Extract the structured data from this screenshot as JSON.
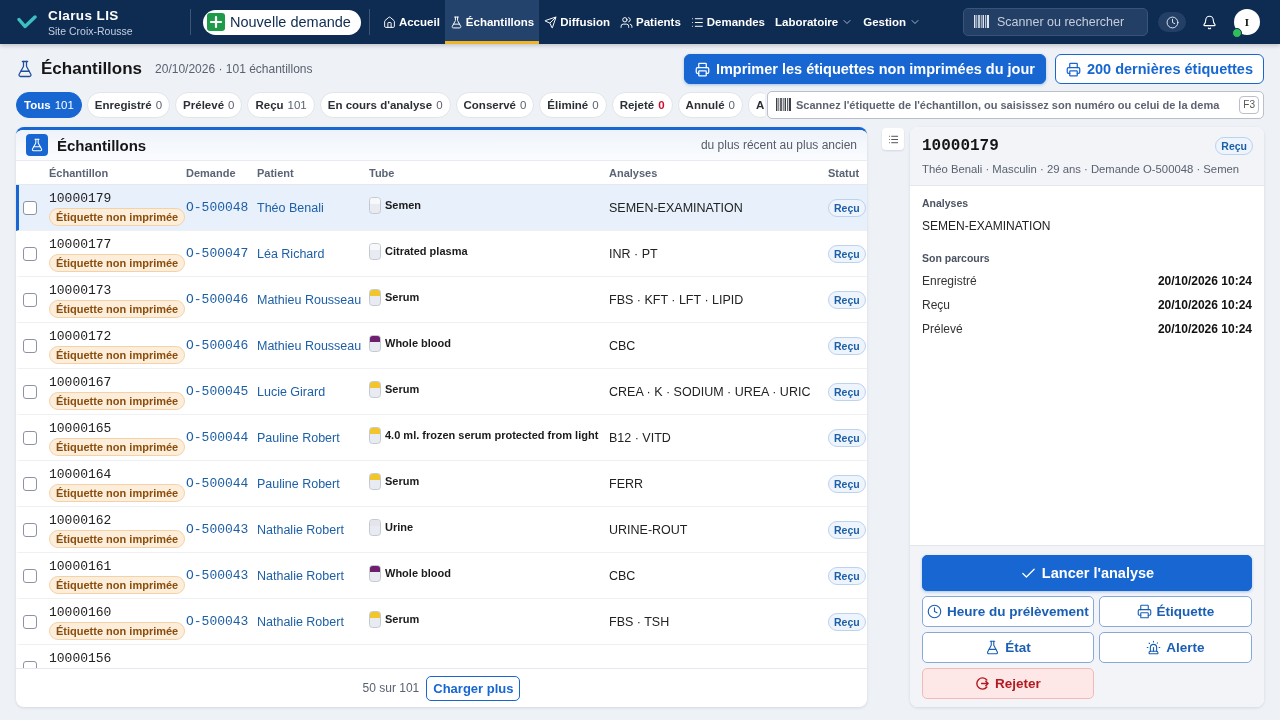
{
  "top_bar": {
    "brand": "Clarus LIS",
    "site": "Site Croix-Rousse",
    "new_request": "Nouvelle demande",
    "nav": [
      {
        "label": "Accueil",
        "kind": "link",
        "selected": false
      },
      {
        "label": "Échantillons",
        "kind": "link",
        "selected": true
      },
      {
        "label": "Diffusion",
        "kind": "link",
        "selected": false
      },
      {
        "label": "Patients",
        "kind": "link",
        "selected": false
      },
      {
        "label": "Demandes",
        "kind": "link",
        "selected": false
      },
      {
        "label": "Laboratoire",
        "kind": "menu",
        "selected": false
      },
      {
        "label": "Gestion",
        "kind": "menu",
        "selected": false
      }
    ],
    "search": {
      "placeholder": "Scanner ou rechercher"
    },
    "user": {
      "initial": "I",
      "online": true
    }
  },
  "page": {
    "title": "Échantillons",
    "subtitle": "20/10/2026 · 101 échantillons",
    "actions": [
      {
        "label": "Imprimer les étiquettes non imprimées du jour",
        "kind": "primary"
      },
      {
        "label": "200 dernières étiquettes",
        "kind": "secondary"
      }
    ]
  },
  "filters": [
    {
      "label": "Tous",
      "count": "101",
      "selected": true,
      "alert": false
    },
    {
      "label": "Enregistré",
      "count": "0",
      "selected": false,
      "alert": false
    },
    {
      "label": "Prélevé",
      "count": "0",
      "selected": false,
      "alert": false
    },
    {
      "label": "Reçu",
      "count": "101",
      "selected": false,
      "alert": false
    },
    {
      "label": "En cours d'analyse",
      "count": "0",
      "selected": false,
      "alert": false
    },
    {
      "label": "Conservé",
      "count": "0",
      "selected": false,
      "alert": false
    },
    {
      "label": "Éliminé",
      "count": "0",
      "selected": false,
      "alert": false
    },
    {
      "label": "Rejeté",
      "count": "0",
      "selected": false,
      "alert": true
    },
    {
      "label": "Annulé",
      "count": "0",
      "selected": false,
      "alert": false
    },
    {
      "label": "A",
      "selected": false
    }
  ],
  "scan_field": {
    "placeholder": "Scannez l'étiquette de l'échantillon, ou saisissez son numéro ou celui de la dema",
    "shortcut": "F3"
  },
  "samples": {
    "title": "Échantillons",
    "sort": "du plus récent au plus ancien",
    "columns": [
      "Échantillon",
      "Demande",
      "Patient",
      "Tube",
      "Analyses",
      "Statut"
    ],
    "rows": [
      {
        "selected": true,
        "checked": false,
        "sample": "10000179",
        "badge": "Étiquette non imprimée",
        "request": "O-500048",
        "patient": "Théo Benali",
        "tube": {
          "name": "Semen",
          "color": "#f7f8fa"
        },
        "analyses": "SEMEN-EXAMINATION",
        "status": "Reçu"
      },
      {
        "selected": false,
        "checked": false,
        "sample": "10000177",
        "badge": "Étiquette non imprimée",
        "request": "O-500047",
        "patient": "Léa Richard",
        "tube": {
          "name": "Citrated plasma",
          "color": "#f7f8fa"
        },
        "analyses": "INR · PT",
        "status": "Reçu"
      },
      {
        "selected": false,
        "checked": false,
        "sample": "10000173",
        "badge": "Étiquette non imprimée",
        "request": "O-500046",
        "patient": "Mathieu Rousseau",
        "tube": {
          "name": "Serum",
          "color": "#f2c52a"
        },
        "analyses": "FBS · KFT · LFT · LIPID",
        "status": "Reçu"
      },
      {
        "selected": false,
        "checked": false,
        "sample": "10000172",
        "badge": "Étiquette non imprimée",
        "request": "O-500046",
        "patient": "Mathieu Rousseau",
        "tube": {
          "name": "Whole blood",
          "color": "#6e1f6e"
        },
        "analyses": "CBC",
        "status": "Reçu"
      },
      {
        "selected": false,
        "checked": false,
        "sample": "10000167",
        "badge": "Étiquette non imprimée",
        "request": "O-500045",
        "patient": "Lucie Girard",
        "tube": {
          "name": "Serum",
          "color": "#f2c52a"
        },
        "analyses": "CREA · K · SODIUM · UREA · URIC",
        "status": "Reçu"
      },
      {
        "selected": false,
        "checked": false,
        "sample": "10000165",
        "badge": "Étiquette non imprimée",
        "request": "O-500044",
        "patient": "Pauline Robert",
        "tube": {
          "name": "4.0 ml. frozen serum protected from light",
          "color": "#f2c52a"
        },
        "analyses": "B12 · VITD",
        "status": "Reçu"
      },
      {
        "selected": false,
        "checked": false,
        "sample": "10000164",
        "badge": "Étiquette non imprimée",
        "request": "O-500044",
        "patient": "Pauline Robert",
        "tube": {
          "name": "Serum",
          "color": "#f2c52a"
        },
        "analyses": "FERR",
        "status": "Reçu"
      },
      {
        "selected": false,
        "checked": false,
        "sample": "10000162",
        "badge": "Étiquette non imprimée",
        "request": "O-500043",
        "patient": "Nathalie Robert",
        "tube": {
          "name": "Urine",
          "color": "#e3e5ea"
        },
        "analyses": "URINE-ROUT",
        "status": "Reçu"
      },
      {
        "selected": false,
        "checked": false,
        "sample": "10000161",
        "badge": "Étiquette non imprimée",
        "request": "O-500043",
        "patient": "Nathalie Robert",
        "tube": {
          "name": "Whole blood",
          "color": "#6e1f6e"
        },
        "analyses": "CBC",
        "status": "Reçu"
      },
      {
        "selected": false,
        "checked": false,
        "sample": "10000160",
        "badge": "Étiquette non imprimée",
        "request": "O-500043",
        "patient": "Nathalie Robert",
        "tube": {
          "name": "Serum",
          "color": "#f2c52a"
        },
        "analyses": "FBS · TSH",
        "status": "Reçu"
      },
      {
        "selected": false,
        "checked": false,
        "sample": "10000156"
      }
    ],
    "footer": {
      "count": "50 sur 101",
      "load_more": "Charger plus"
    }
  },
  "detail": {
    "sample": "10000179",
    "status": "Reçu",
    "summary": "Théo Benali · Masculin · 29 ans · Demande O-500048 · Semen",
    "analyses_label": "Analyses",
    "analyses": "SEMEN-EXAMINATION",
    "history_label": "Son parcours",
    "history": [
      {
        "step": "Enregistré",
        "time": "20/10/2026 10:24"
      },
      {
        "step": "Reçu",
        "time": "20/10/2026 10:24"
      },
      {
        "step": "Prélevé",
        "time": "20/10/2026 10:24"
      }
    ],
    "actions": [
      {
        "label": "Lancer l'analyse",
        "kind": "primary"
      },
      {
        "label": "Heure du prélèvement",
        "kind": "secondary"
      },
      {
        "label": "Étiquette",
        "kind": "secondary"
      },
      {
        "label": "État",
        "kind": "secondary"
      },
      {
        "label": "Alerte",
        "kind": "secondary"
      },
      {
        "label": "Rejeter",
        "kind": "danger"
      }
    ]
  }
}
